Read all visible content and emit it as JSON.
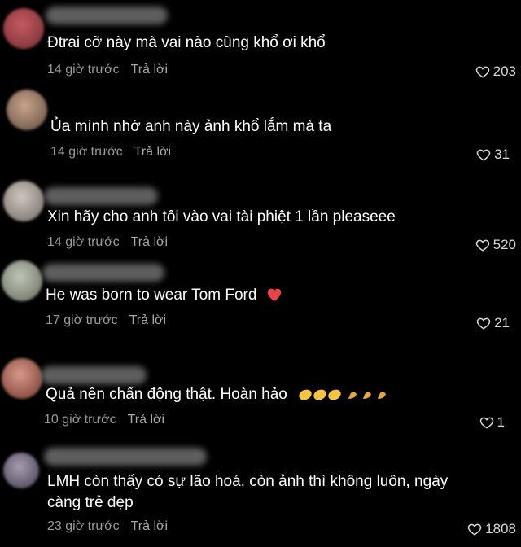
{
  "comments": [
    {
      "text": "Đtrai cỡ này mà vai nào cũng khổ ơi khổ",
      "time": "14 giờ trước",
      "reply": "Trả lời",
      "likes": "203",
      "avatar_color": "#b05055"
    },
    {
      "text": "Ủa mình nhớ anh này ảnh khổ lắm mà ta",
      "time": "14 giờ trước",
      "reply": "Trả lời",
      "likes": "31",
      "avatar_color": "#b08e78"
    },
    {
      "text": "Xin hãy cho anh tôi vào vai tài phiệt 1 lần pleaseee",
      "time": "14 giờ trước",
      "reply": "Trả lời",
      "likes": "520",
      "avatar_color": "#b4aaa3"
    },
    {
      "text": "He was born to wear Tom Ford",
      "emoji": "heart",
      "time": "17 giờ trước",
      "reply": "Trả lời",
      "likes": "21",
      "avatar_color": "#a4aa9c"
    },
    {
      "text": "Quả nền chấn động thật. Hoàn hảo",
      "emoji": "clapping-hands",
      "time": "10 giờ trước",
      "reply": "Trả lời",
      "likes": "1",
      "avatar_color": "#c78070"
    },
    {
      "text": "LMH còn thấy có sự lão hoá, còn ảnh thì không luôn, ngày càng trẻ đẹp",
      "time": "23 giờ trước",
      "reply": "Trả lời",
      "likes": "1808",
      "avatar_color": "#8c8494"
    }
  ]
}
